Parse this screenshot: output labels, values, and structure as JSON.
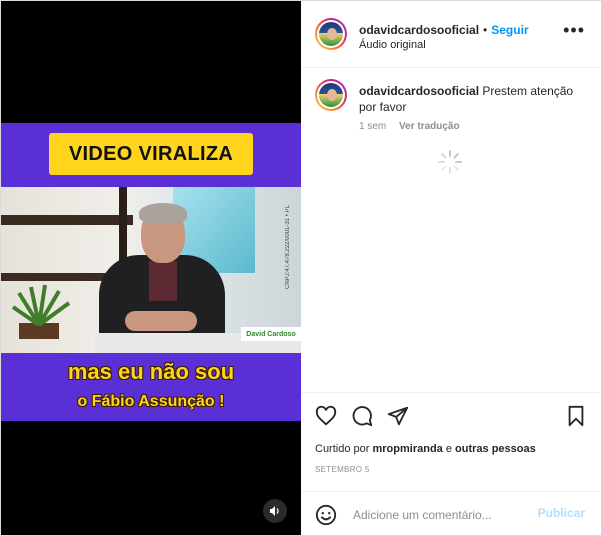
{
  "video": {
    "banner_text": "VIDEO VIRALIZA",
    "caption_line1": "mas eu não sou",
    "caption_line2": "o Fábio Assunção !",
    "name_tag": "David Cardoso",
    "side_text": "CNPJ:47.478.222/0001-31 • PL",
    "sound_icon": "speaker-icon"
  },
  "post": {
    "username": "odavidcardosooficial",
    "separator": "•",
    "follow_label": "Seguir",
    "audio_label": "Áudio original",
    "more_icon": "more-options-icon"
  },
  "comment": {
    "username": "odavidcardosooficial",
    "text": "Prestem atenção por favor",
    "time": "1 sem",
    "translate_label": "Ver tradução"
  },
  "actions": {
    "icons": [
      "heart-icon",
      "comment-icon",
      "share-icon",
      "bookmark-icon"
    ],
    "liked_prefix": "Curtido por",
    "liked_user": "mropmiranda",
    "liked_join": "e",
    "liked_others": "outras pessoas",
    "date": "SETEMBRO 5"
  },
  "add_comment": {
    "placeholder": "Adicione um comentário...",
    "publish_label": "Publicar",
    "emoji_icon": "emoji-icon"
  },
  "colors": {
    "accent": "#0095f6",
    "publish_disabled": "#b2dffc",
    "banner_yellow": "#ffd41c",
    "video_purple": "#5b2fd6"
  }
}
